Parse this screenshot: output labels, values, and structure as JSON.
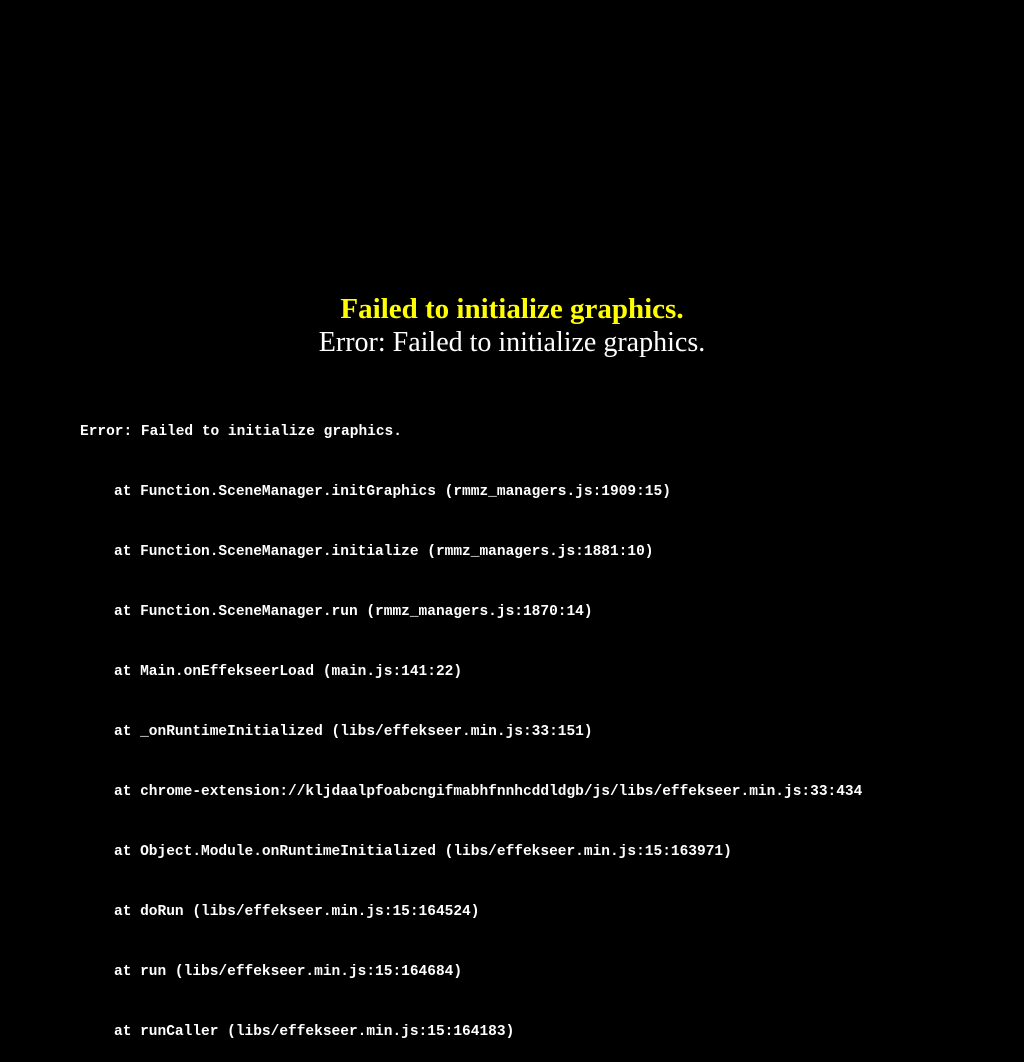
{
  "error": {
    "title": "Failed to initialize graphics.",
    "subtitle": "Error: Failed to initialize graphics.",
    "stack_header": "Error: Failed to initialize graphics.",
    "stack": [
      "at Function.SceneManager.initGraphics (rmmz_managers.js:1909:15)",
      "at Function.SceneManager.initialize (rmmz_managers.js:1881:10)",
      "at Function.SceneManager.run (rmmz_managers.js:1870:14)",
      "at Main.onEffekseerLoad (main.js:141:22)",
      "at _onRuntimeInitialized (libs/effekseer.min.js:33:151)",
      "at chrome-extension://kljdaalpfoabcngifmabhfnnhcddldgb/js/libs/effekseer.min.js:33:434",
      "at Object.Module.onRuntimeInitialized (libs/effekseer.min.js:15:163971)",
      "at doRun (libs/effekseer.min.js:15:164524)",
      "at run (libs/effekseer.min.js:15:164684)",
      "at runCaller (libs/effekseer.min.js:15:164183)"
    ]
  }
}
